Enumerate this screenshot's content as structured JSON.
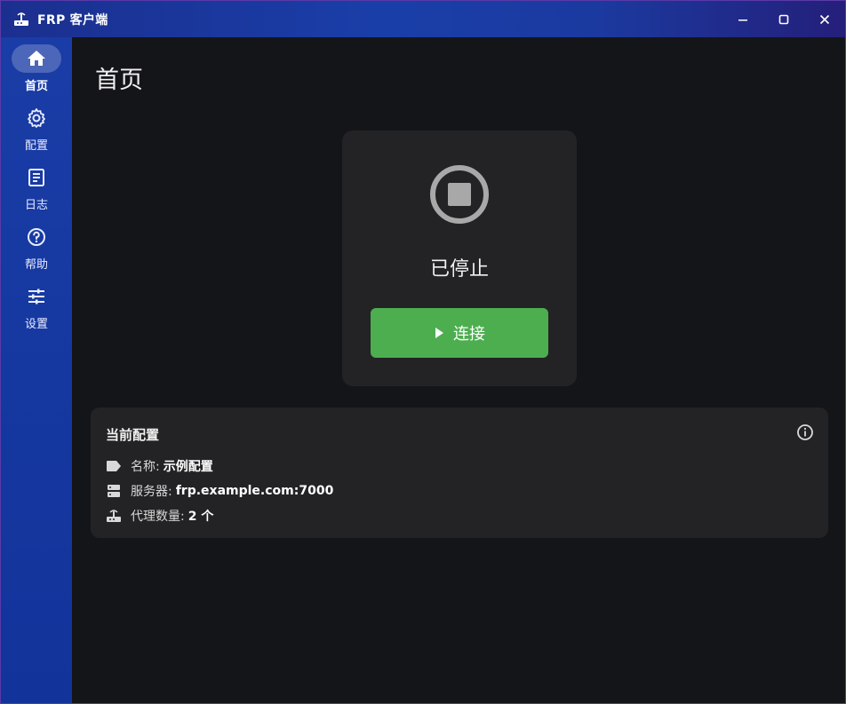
{
  "window": {
    "title": "FRP 客户端"
  },
  "sidebar": {
    "items": [
      {
        "label": "首页",
        "icon": "home-icon",
        "active": true
      },
      {
        "label": "配置",
        "icon": "gear-icon",
        "active": false
      },
      {
        "label": "日志",
        "icon": "document-icon",
        "active": false
      },
      {
        "label": "帮助",
        "icon": "help-icon",
        "active": false
      },
      {
        "label": "设置",
        "icon": "sliders-icon",
        "active": false
      }
    ]
  },
  "main": {
    "page_title": "首页",
    "status": {
      "text": "已停止",
      "icon": "stop-circle-icon",
      "button_label": "连接",
      "button_color": "#4cae4f"
    },
    "config": {
      "title": "当前配置",
      "name_label": "名称:",
      "name_value": "示例配置",
      "server_label": "服务器:",
      "server_value": "frp.example.com:7000",
      "proxy_label": "代理数量:",
      "proxy_value": "2 个"
    }
  },
  "colors": {
    "accent": "#1a3ea8",
    "success": "#4cae4f",
    "background": "#141519",
    "card": "#232325"
  }
}
